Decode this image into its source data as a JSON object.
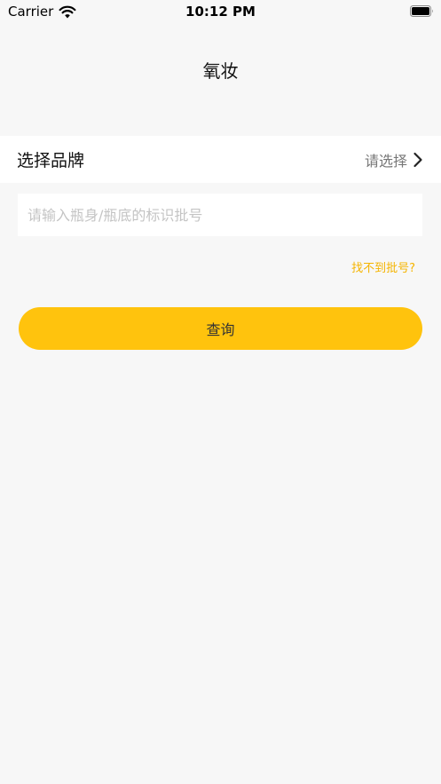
{
  "status_bar": {
    "carrier": "Carrier",
    "time": "10:12 PM"
  },
  "nav": {
    "title": "氧妆"
  },
  "brand": {
    "label": "选择品牌",
    "value": "请选择"
  },
  "batch": {
    "placeholder": "请输入瓶身/瓶底的标识批号",
    "value": ""
  },
  "help": {
    "link_label": "找不到批号?"
  },
  "actions": {
    "query_label": "查询"
  },
  "colors": {
    "accent": "#ffc30d",
    "link": "#f5b400",
    "background": "#f7f7f7"
  },
  "icons": {
    "wifi": "wifi-icon",
    "battery": "battery-icon",
    "chevron": "chevron-right-icon"
  }
}
